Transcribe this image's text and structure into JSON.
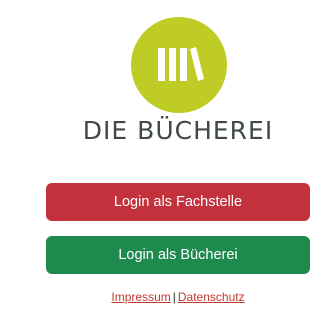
{
  "brand": {
    "logo_icon": "books-icon",
    "logo_color": "#bfcc26",
    "title": "DIE BÜCHEREI",
    "title_color": "#404a42"
  },
  "buttons": {
    "fachstelle": {
      "label": "Login als Fachstelle",
      "color": "#c2313c"
    },
    "buecherei": {
      "label": "Login als Bücherei",
      "color": "#1e8a4e"
    }
  },
  "footer": {
    "impressum": "Impressum",
    "separator": "|",
    "datenschutz": "Datenschutz",
    "link_color": "#c0392b"
  }
}
